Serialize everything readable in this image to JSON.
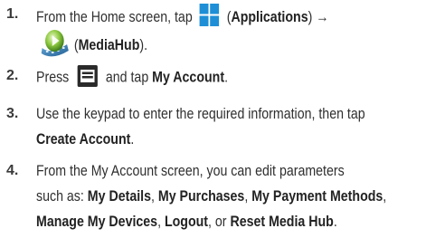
{
  "steps": [
    {
      "number": "1.",
      "line1_prefix": "From the Home screen, tap",
      "line1_paren_open": "(",
      "line1_bold": "Applications",
      "line1_suffix": ") →",
      "line2_paren_open": "(",
      "line2_bold": "MediaHub",
      "line2_suffix": ").",
      "icon1": "applications-grid-icon",
      "icon2": "mediahub-icon"
    },
    {
      "number": "2.",
      "prefix": "Press",
      "middle": "and tap",
      "bold": "My Account",
      "suffix": ".",
      "icon": "menu-key-icon"
    },
    {
      "number": "3.",
      "line1": "Use the keypad to enter the required information, then tap",
      "line2_bold": "Create Account",
      "line2_suffix": "."
    },
    {
      "number": "4.",
      "line1": "From the My Account screen, you can edit parameters",
      "line2_prefix": "such as: ",
      "line2_b1": "My Details",
      "line2_sep1": ", ",
      "line2_b2": "My Purchases",
      "line2_sep2": ", ",
      "line2_b3": "My Payment Methods",
      "line2_sep3": ",",
      "line3_b1": "Manage My Devices",
      "line3_sep1": ", ",
      "line3_b2": "Logout",
      "line3_sep2": ", or ",
      "line3_b3": "Reset Media Hub",
      "line3_suffix": "."
    }
  ],
  "colors": {
    "text": "#2f2f2f",
    "apps_icon_blue": "#1e8fd6",
    "menu_icon_dark": "#2a2a2a"
  }
}
